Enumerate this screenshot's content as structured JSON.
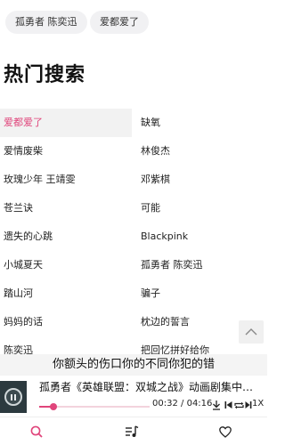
{
  "history_tags": [
    {
      "label": "孤勇者 陈奕迅"
    },
    {
      "label": "爱都爱了"
    }
  ],
  "section_title": "热门搜索",
  "hot_search": {
    "left": [
      "爱都爱了",
      "爱情废柴",
      "玫瑰少年 王靖雯",
      "苍兰诀",
      "遗失的心跳",
      "小城夏天",
      "踏山河",
      "妈妈的话",
      "陈奕迅"
    ],
    "right": [
      "缺氧",
      "林俊杰",
      "邓紫棋",
      "可能",
      "Blackpink",
      "孤勇者 陈奕迅",
      "骗子",
      "枕边的誓言",
      "把回忆拼好给你"
    ]
  },
  "active_item": "爱都爱了",
  "lyric": "你额头的伤口你的不同你犯的错",
  "player": {
    "song_title": "孤勇者《英雄联盟：双城之战》动画剧集中…",
    "current_time": "00:32",
    "separator": "/",
    "total_time": "04:16",
    "progress": 0.125,
    "speed_label": "1X"
  },
  "colors": {
    "accent": "#e0457b",
    "active_bg": "#f2f2f2",
    "tag_bg": "#f1f1f3",
    "lyric_bg": "#f4f4f4"
  },
  "icons": {
    "scroll_top": "chevron-up-icon",
    "play_pause": "pause-icon",
    "download": "download-icon",
    "prev": "skip-previous-icon",
    "repeat": "repeat-icon",
    "next": "skip-next-icon",
    "tab_search": "search-icon",
    "tab_playlist": "playlist-icon",
    "tab_favorites": "heart-icon"
  }
}
